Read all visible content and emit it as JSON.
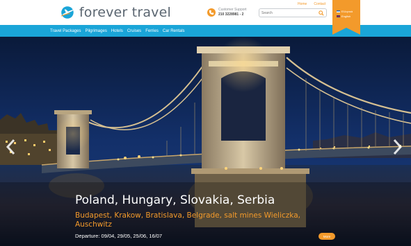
{
  "header": {
    "brand": "forever travel",
    "support_label": "Customer Support",
    "support_phone": "210 3228981 - 2",
    "search_placeholder": "Search",
    "top_links": [
      {
        "label": "Home"
      },
      {
        "label": "Contact"
      }
    ],
    "languages": [
      {
        "label": "Ελληνικά"
      },
      {
        "label": "English"
      }
    ]
  },
  "nav": {
    "items": [
      {
        "label": "Travel Packages"
      },
      {
        "label": "Pilgrimages"
      },
      {
        "label": "Hotels"
      },
      {
        "label": "Cruises"
      },
      {
        "label": "Ferries"
      },
      {
        "label": "Car Rentals"
      }
    ]
  },
  "hero": {
    "title": "Poland, Hungary, Slovakia, Serbia",
    "cities": "Budapest, Krakow, Bratislava, Belgrade, salt mines Wieliczka, Auschwitz",
    "departure": "Departure: 09/04, 29/05, 25/06, 16/07",
    "more_label": "More"
  },
  "colors": {
    "accent_orange": "#f39a2b",
    "nav_blue": "#1aa5d8",
    "logo_text": "#5a6570"
  },
  "icons": {
    "support": "phone-icon",
    "search": "search-icon",
    "prev": "chevron-left-icon",
    "next": "chevron-right-icon"
  }
}
